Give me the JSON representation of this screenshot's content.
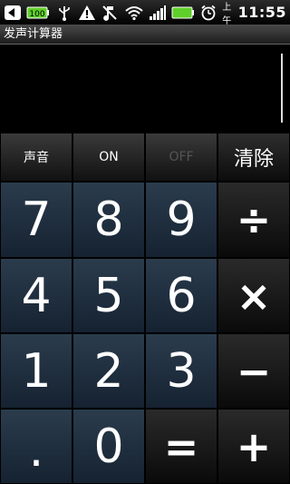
{
  "status_bar": {
    "icons": [
      "back-icon",
      "battery-100-icon",
      "usb-icon",
      "warning-icon",
      "mute-icon",
      "wifi-icon",
      "signal-icon",
      "battery-icon",
      "alarm-icon"
    ],
    "battery_label": "100",
    "am_pm": "上午",
    "time": "11:55"
  },
  "app": {
    "title": "发声计算器"
  },
  "display": {
    "value": ""
  },
  "keypad": {
    "func": {
      "sound": "声音",
      "on": "ON",
      "off": "OFF",
      "clear": "清除"
    },
    "digits": {
      "d7": "7",
      "d8": "8",
      "d9": "9",
      "d4": "4",
      "d5": "5",
      "d6": "6",
      "d1": "1",
      "d2": "2",
      "d3": "3",
      "dot": ".",
      "d0": "0"
    },
    "ops": {
      "divide": "÷",
      "multiply": "×",
      "minus": "−",
      "equals": "=",
      "plus": "+"
    }
  },
  "colors": {
    "digit_bg": "#1e2e3f",
    "op_bg": "#1a1a1a",
    "func_bg": "#262626",
    "off_text": "#555555"
  }
}
